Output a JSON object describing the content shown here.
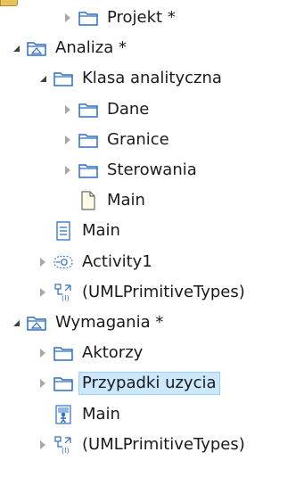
{
  "tree": {
    "items": [
      {
        "label": "Projekt *",
        "icon": "folder-icon",
        "state": "collapsed"
      },
      {
        "label": "Analiza *",
        "icon": "package-diagram-icon",
        "state": "expanded"
      },
      {
        "label": "Klasa analityczna",
        "icon": "folder-icon",
        "state": "expanded"
      },
      {
        "label": "Dane",
        "icon": "folder-icon",
        "state": "collapsed"
      },
      {
        "label": "Granice",
        "icon": "folder-icon",
        "state": "collapsed"
      },
      {
        "label": "Sterowania",
        "icon": "folder-icon",
        "state": "collapsed"
      },
      {
        "label": "Main",
        "icon": "diagram-page-icon",
        "state": "leaf"
      },
      {
        "label": "Main",
        "icon": "document-icon",
        "state": "leaf"
      },
      {
        "label": "Activity1",
        "icon": "activity-icon",
        "state": "collapsed"
      },
      {
        "label": "(UMLPrimitiveTypes)",
        "icon": "primitive-types-icon",
        "state": "collapsed"
      },
      {
        "label": "Wymagania *",
        "icon": "package-diagram-icon",
        "state": "expanded"
      },
      {
        "label": "Aktorzy",
        "icon": "folder-icon",
        "state": "collapsed"
      },
      {
        "label": "Przypadki uzycia",
        "icon": "folder-icon",
        "state": "collapsed",
        "selected": true
      },
      {
        "label": "Main",
        "icon": "use-case-diagram-icon",
        "state": "leaf"
      },
      {
        "label": "(UMLPrimitiveTypes)",
        "icon": "primitive-types-icon",
        "state": "collapsed"
      }
    ]
  },
  "colors": {
    "selection_background": "#cce8ff",
    "selection_border": "#99d1ff",
    "folder_outline": "#2f6fbf"
  }
}
